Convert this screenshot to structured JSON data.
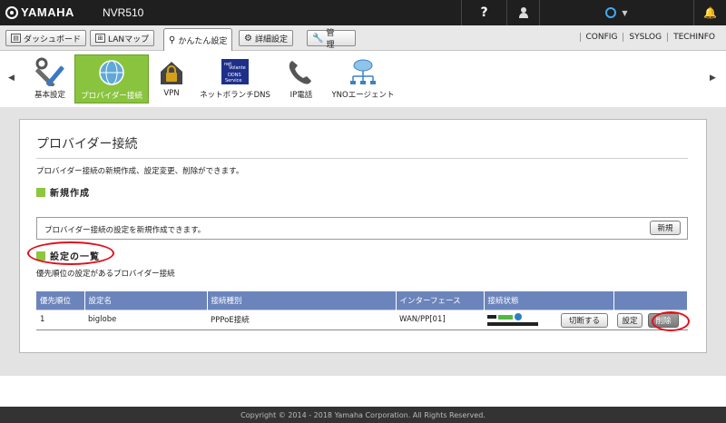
{
  "header": {
    "brand": "YAMAHA",
    "model": "NVR510",
    "help": "?"
  },
  "tabs": [
    {
      "label": "ダッシュボード"
    },
    {
      "label": "LANマップ"
    },
    {
      "label": "かんたん設定"
    },
    {
      "label": "詳細設定"
    },
    {
      "label": "管　理"
    }
  ],
  "toplinks": [
    "CONFIG",
    "SYSLOG",
    "TECHINFO"
  ],
  "nav": [
    {
      "label": "基本設定"
    },
    {
      "label": "プロバイダー接続"
    },
    {
      "label": "VPN"
    },
    {
      "label": "ネットボランチDNS",
      "badge": [
        "net",
        "Volante",
        "DDNS",
        "Service"
      ]
    },
    {
      "label": "IP電話"
    },
    {
      "label": "YNOエージェント"
    }
  ],
  "page": {
    "title": "プロバイダー接続",
    "description": "プロバイダー接続の新規作成、設定変更、削除ができます。",
    "new_section": "新規作成",
    "new_desc": "プロバイダー接続の設定を新規作成できます。",
    "new_button": "新規",
    "list_section": "設定の一覧",
    "list_desc": "優先順位の設定があるプロバイダー接続"
  },
  "table": {
    "headers": [
      "優先順位",
      "設定名",
      "接続種別",
      "インターフェース",
      "接続状態",
      ""
    ],
    "rows": [
      {
        "priority": "1",
        "name": "biglobe",
        "type": "PPPoE接続",
        "iface": "WAN/PP[01]",
        "disconnect": "切断する",
        "settings": "設定",
        "delete": "削除"
      }
    ]
  },
  "footer": "Copyright © 2014 - 2018 Yamaha Corporation. All Rights Reserved."
}
